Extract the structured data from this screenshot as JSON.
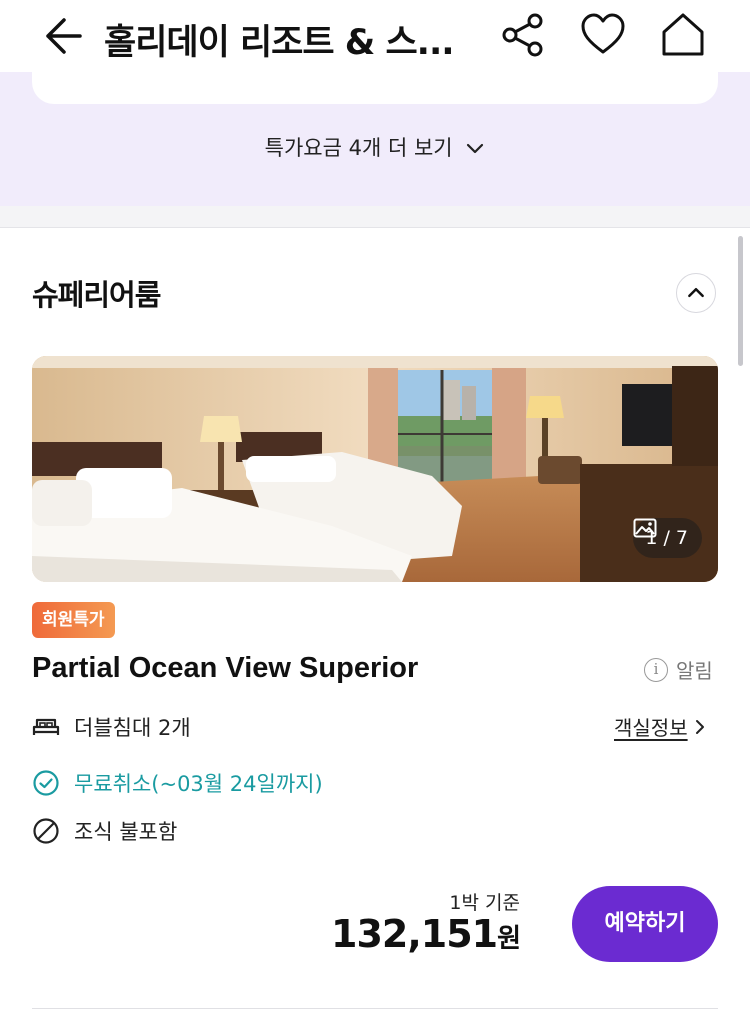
{
  "header": {
    "title": "홀리데이 리조트 & 스...",
    "icons": [
      "back-arrow-icon",
      "share-icon",
      "heart-icon",
      "home-icon"
    ]
  },
  "rates": {
    "more_label": "특가요금 4개 더 보기"
  },
  "room": {
    "name": "슈페리어룸",
    "photo_counter": "1 / 7",
    "badge": "회원특가",
    "title": "Partial Ocean View Superior",
    "alarm_label": "알림",
    "bed": "더블침대 2개",
    "room_info_link": "객실정보",
    "cancellation": "무료취소(~03월 24일까지)",
    "breakfast": "조식 불포함",
    "price_basis": "1박 기준",
    "price": "132,151",
    "currency": "원",
    "book_button": "예약하기"
  },
  "colors": {
    "accent": "#6b2bd1",
    "band": "#f1ecfb",
    "cancel_teal": "#1a9ba1",
    "badge_orange": "#ef6a3a"
  }
}
